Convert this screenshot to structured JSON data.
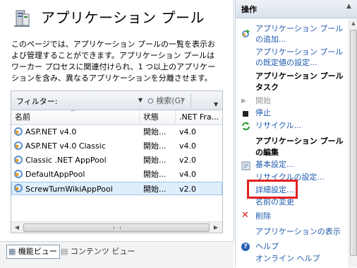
{
  "page": {
    "title": "アプリケーション プール",
    "description": "このページでは、アプリケーション プールの一覧を表示および管理することができます。アプリケーション プールはワーカー プロセスに関連付けられ、1 つ以上のアプリケーションを含み、異なるアプリケーションを分離させます。"
  },
  "filterbar": {
    "label": "フィルター:",
    "search_label": "検索(G)"
  },
  "table": {
    "columns": [
      "名前",
      "状態",
      ".NET Fra..."
    ],
    "rows": [
      {
        "name": "ASP.NET v4.0",
        "status": "開始...",
        "net": "v4.0"
      },
      {
        "name": "ASP.NET v4.0 Classic",
        "status": "開始...",
        "net": "v4.0"
      },
      {
        "name": "Classic .NET AppPool",
        "status": "開始...",
        "net": "v2.0"
      },
      {
        "name": "DefaultAppPool",
        "status": "開始...",
        "net": "v4.0"
      },
      {
        "name": "ScrewTurnWikiAppPool",
        "status": "開始...",
        "net": "v2.0"
      }
    ],
    "selected_index": 4
  },
  "viewtabs": {
    "features": "機能ビュー",
    "content": "コンテンツ ビュー"
  },
  "actions": {
    "header": "操作",
    "add_pool_1": "アプリケーション プール",
    "add_pool_2": "の追加...",
    "set_defaults_1": "アプリケーション プール",
    "set_defaults_2": "の既定値の設定...",
    "tasks_1": "アプリケーション プール",
    "tasks_2": "タスク",
    "start": "開始",
    "stop": "停止",
    "recycle": "リサイクル...",
    "edit_1": "アプリケーション プール",
    "edit_2": "の編集",
    "basic_settings": "基本設定...",
    "recycle_settings": "リサイクルの設定...",
    "advanced_settings": "詳細設定...",
    "rename": "名前の変更",
    "delete": "削除",
    "view_apps": "アプリケーションの表示",
    "help": "ヘルプ",
    "online_help": "オンライン ヘルプ"
  },
  "colors": {
    "link": "#1f5aad",
    "highlight": "#e41e1e",
    "selection": "#dfeefc"
  }
}
